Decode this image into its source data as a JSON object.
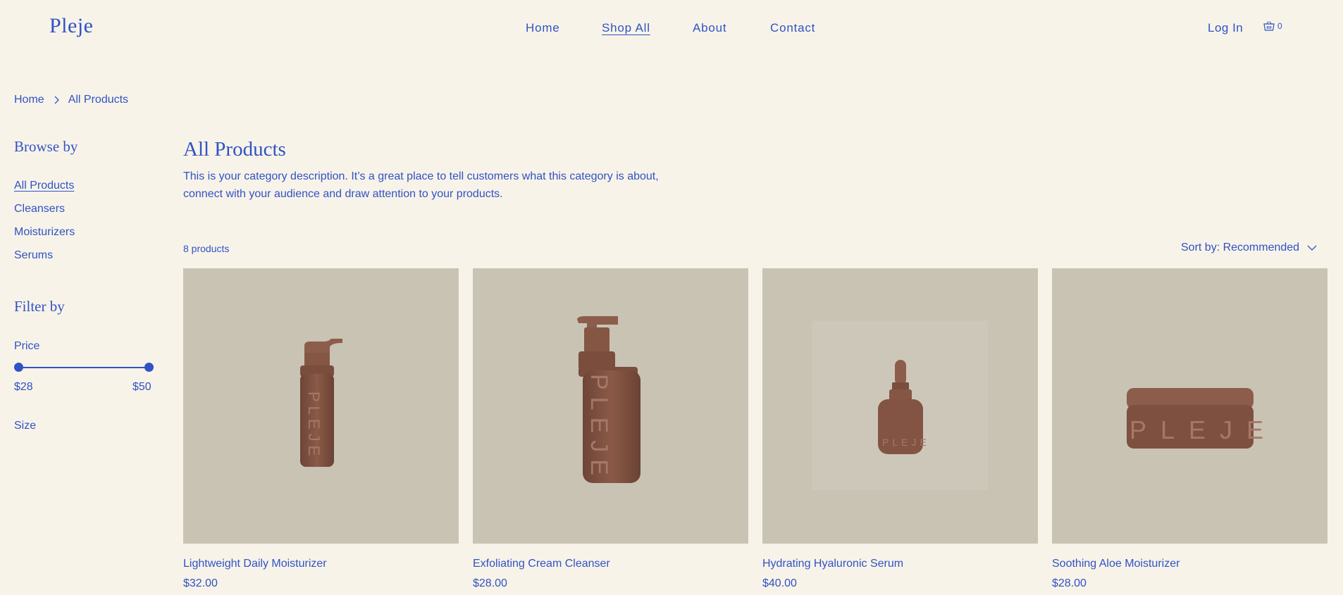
{
  "header": {
    "logo": "Pleje",
    "nav": [
      {
        "label": "Home"
      },
      {
        "label": "Shop All"
      },
      {
        "label": "About"
      },
      {
        "label": "Contact"
      }
    ],
    "login": "Log In",
    "cart_count": "0"
  },
  "breadcrumb": {
    "home": "Home",
    "current": "All Products"
  },
  "sidebar": {
    "browse_title": "Browse by",
    "categories": [
      {
        "label": "All Products"
      },
      {
        "label": "Cleansers"
      },
      {
        "label": "Moisturizers"
      },
      {
        "label": "Serums"
      }
    ],
    "filter_title": "Filter by",
    "price_label": "Price",
    "price_min": "$28",
    "price_max": "$50",
    "size_label": "Size"
  },
  "main": {
    "title": "All Products",
    "description": "This is your category description. It’s a great place to tell customers what this category is about, connect with your audience and draw attention to your products.",
    "product_count": "8 products",
    "sort_label": "Sort by: Recommended",
    "products": [
      {
        "name": "Lightweight Daily Moisturizer",
        "price": "$32.00"
      },
      {
        "name": "Exfoliating Cream Cleanser",
        "price": "$28.00"
      },
      {
        "name": "Hydrating Hyaluronic Serum",
        "price": "$40.00"
      },
      {
        "name": "Soothing Aloe Moisturizer",
        "price": "$28.00"
      }
    ]
  },
  "colors": {
    "background": "#f8f3e9",
    "accent": "#2f53c4",
    "product_bg": "#c9c3b4",
    "product_brown": "#7a4f3f"
  }
}
